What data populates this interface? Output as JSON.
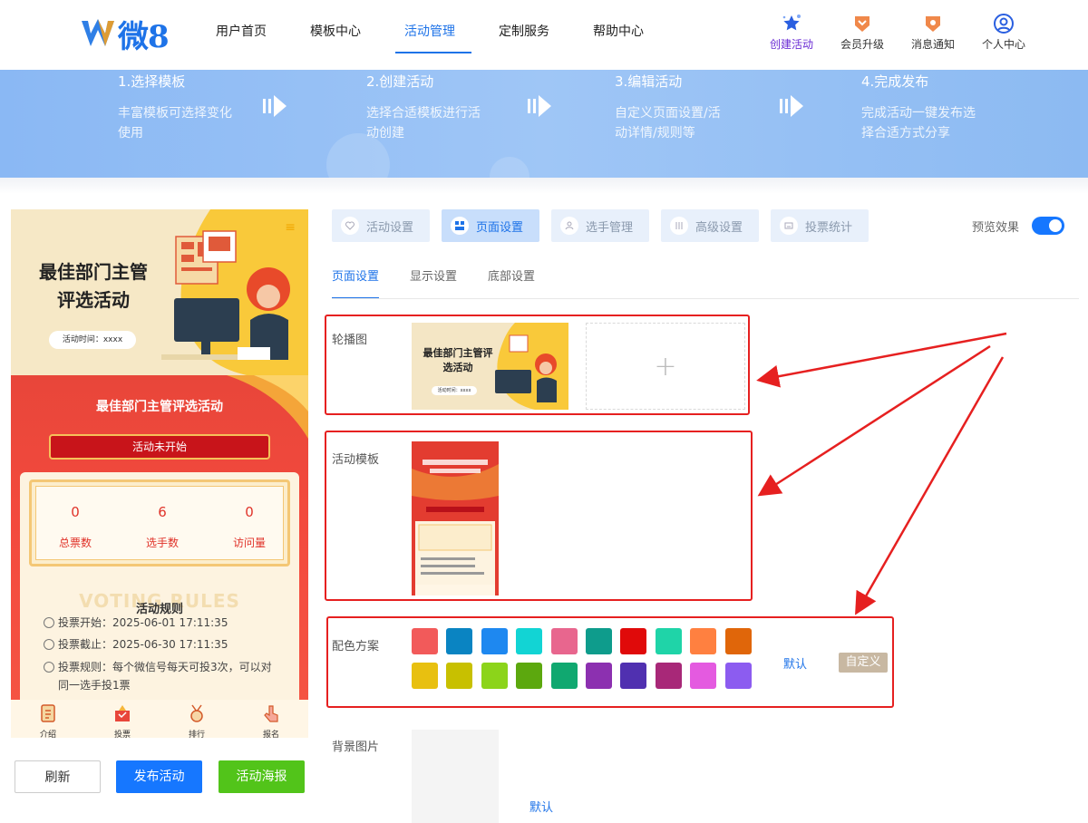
{
  "header": {
    "logo_text": "微8",
    "nav": [
      "用户首页",
      "模板中心",
      "活动管理",
      "定制服务",
      "帮助中心"
    ],
    "icons": [
      {
        "label": "创建活动",
        "icon": "star-icon"
      },
      {
        "label": "会员升级",
        "icon": "vip-badge-icon"
      },
      {
        "label": "消息通知",
        "icon": "bell-badge-icon"
      },
      {
        "label": "个人中心",
        "icon": "user-icon"
      }
    ]
  },
  "steps": [
    {
      "title": "1.选择模板",
      "desc": "丰富模板可选择变化使用"
    },
    {
      "title": "2.创建活动",
      "desc": "选择合适模板进行活动创建"
    },
    {
      "title": "3.编辑活动",
      "desc": "自定义页面设置/活动详情/规则等"
    },
    {
      "title": "4.完成发布",
      "desc": "完成活动一键发布选择合适方式分享"
    }
  ],
  "preview": {
    "title": "最佳部门主管评选活动",
    "time": "活动时间：xxxx",
    "menu": "≡",
    "subtitle": "最佳部门主管评选活动",
    "status": "活动未开始",
    "stats": [
      {
        "value": "0",
        "label": "总票数"
      },
      {
        "value": "6",
        "label": "选手数"
      },
      {
        "value": "0",
        "label": "访问量"
      }
    ],
    "rules_bg": "VOTING RULES",
    "rules_title": "活动规则",
    "rules": [
      "投票开始：2025-06-01 17:11:35",
      "投票截止：2025-06-30 17:11:35",
      "投票规则：每个微信号每天可投3次，可以对同一选手投1票"
    ],
    "tabs": [
      "介绍",
      "投票",
      "排行",
      "报名"
    ]
  },
  "actions": {
    "refresh": "刷新",
    "publish": "发布活动",
    "poster": "活动海报"
  },
  "tabs": [
    "活动设置",
    "页面设置",
    "选手管理",
    "高级设置",
    "投票统计"
  ],
  "preview_label": "预览效果",
  "subtabs": [
    "页面设置",
    "显示设置",
    "底部设置"
  ],
  "fields": {
    "carousel": "轮播图",
    "template": "活动模板",
    "colors": "配色方案",
    "background": "背景图片"
  },
  "carousel_img": {
    "title": "最佳部门主管评选活动",
    "time": "活动时间：xxxx"
  },
  "add_symbol": "+",
  "color_scheme": {
    "row1": [
      "#f25a5a",
      "#0a84c2",
      "#1e88f0",
      "#12d4d4",
      "#e8668e",
      "#0e9c8c",
      "#e00a0a",
      "#1fd4a8",
      "#ff8040",
      "#e0660a"
    ],
    "row2": [
      "#e8c010",
      "#c8c000",
      "#8cd41a",
      "#5ca80e",
      "#10a870",
      "#8c30b0",
      "#5030b0",
      "#a82878",
      "#e45ae0",
      "#8c5cf0"
    ],
    "default_link": "默认",
    "custom_button": "自定义"
  },
  "bg_default": "默认"
}
